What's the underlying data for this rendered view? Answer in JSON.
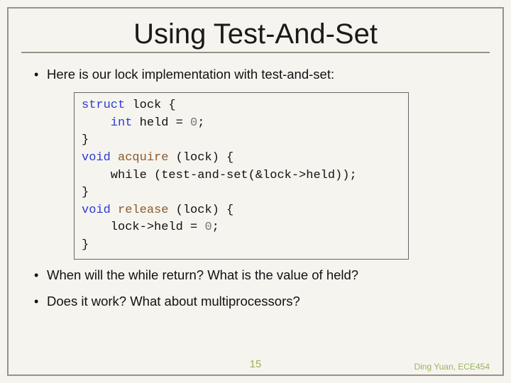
{
  "title": "Using Test-And-Set",
  "bullet1": "Here is our lock implementation with test-and-set:",
  "bullet2": "When will the while return?  What is the value of held?",
  "bullet3": "Does it work? What about multiprocessors?",
  "code": {
    "l1a": "struct",
    "l1b": " lock {",
    "l2a": "    int",
    "l2b": " held = ",
    "l2c": "0",
    "l2d": ";",
    "l3": "}",
    "l4a": "void",
    "l4b": " acquire ",
    "l4c": "(lock) {",
    "l5": "    while (test-and-set(&lock->held));",
    "l6": "}",
    "l7a": "void",
    "l7b": " release ",
    "l7c": "(lock) {",
    "l8a": "    lock->held = ",
    "l8b": "0",
    "l8c": ";",
    "l9": "}"
  },
  "slide_number": "15",
  "attribution": "Ding Yuan, ECE454"
}
